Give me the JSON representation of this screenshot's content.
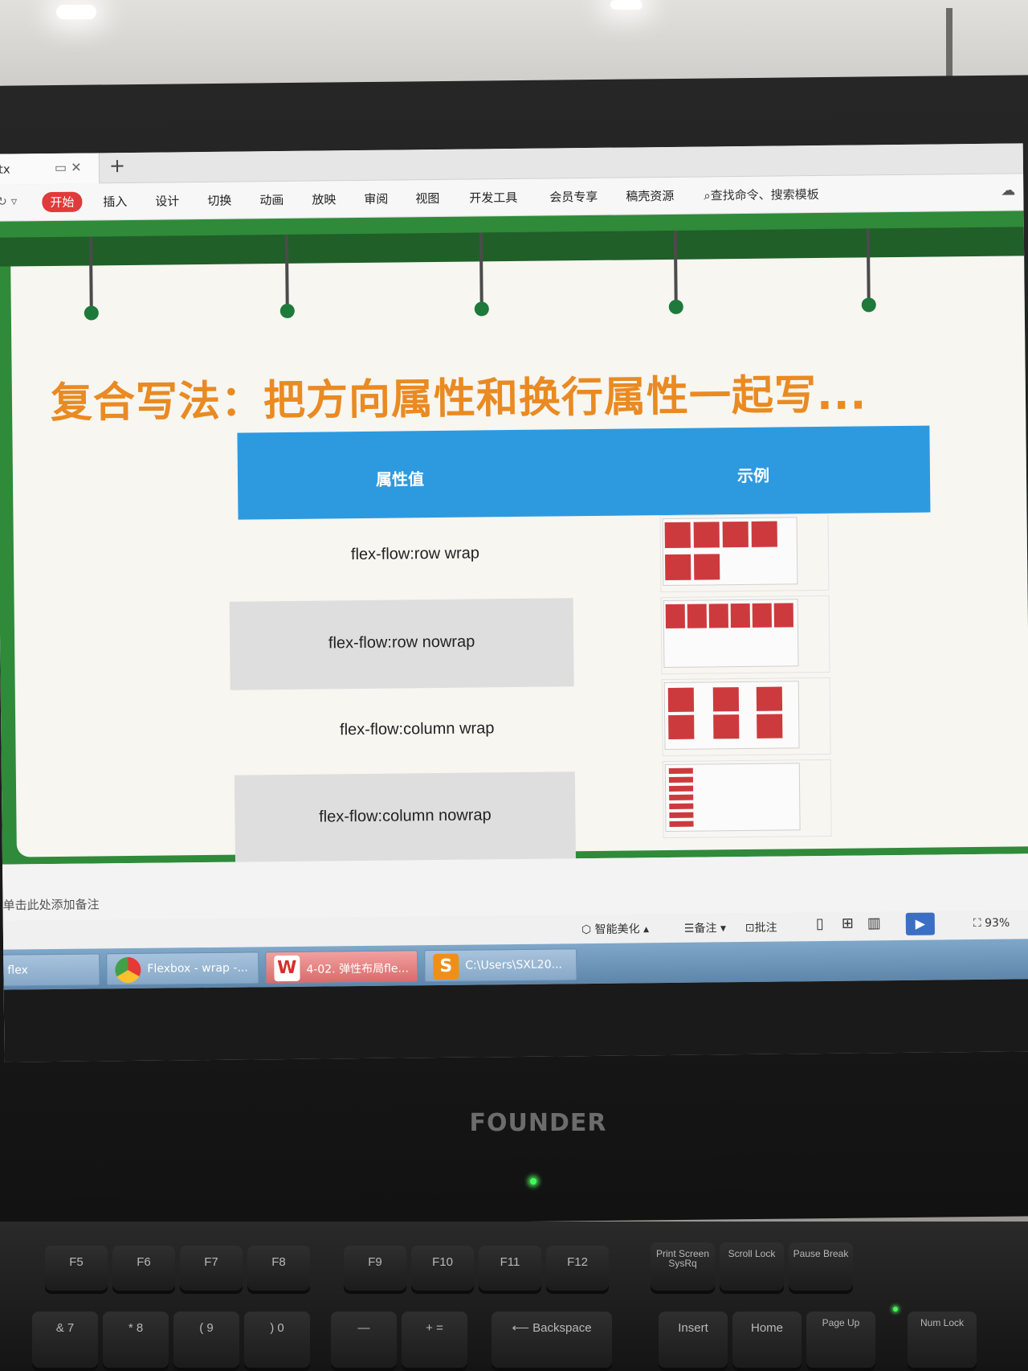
{
  "app": {
    "tab_name": "tx",
    "ribbon": [
      "开始",
      "插入",
      "设计",
      "切换",
      "动画",
      "放映",
      "审阅",
      "视图",
      "开发工具",
      "会员专享",
      "稿壳资源"
    ],
    "search_label": "查找命令、搜索模板"
  },
  "slide": {
    "title": "复合写法：把方向属性和换行属性一起写...",
    "table": {
      "headers": [
        "属性值",
        "示例"
      ],
      "rows": [
        {
          "label": "flex-flow:row wrap"
        },
        {
          "label": "flex-flow:row nowrap"
        },
        {
          "label": "flex-flow:column wrap"
        },
        {
          "label": "flex-flow:column nowrap"
        }
      ]
    }
  },
  "notes": {
    "placeholder": "单击此处添加备注"
  },
  "statusbar": {
    "beautify": "智能美化",
    "notes": "备注",
    "comments": "批注",
    "zoom": "93%"
  },
  "taskbar": [
    {
      "label": "flex"
    },
    {
      "label": "Flexbox - wrap -..."
    },
    {
      "label": "4-02. 弹性布局fle..."
    },
    {
      "label": "C:\\Users\\SXL20..."
    }
  ],
  "monitor": {
    "brand": "FOUNDER"
  },
  "keyboard": {
    "top_row": [
      "F5",
      "F6",
      "F7",
      "F8",
      "F9",
      "F10",
      "F11",
      "F12",
      "Print Screen SysRq",
      "Scroll Lock",
      "Pause Break"
    ],
    "bottom_row": [
      "& 7",
      "* 8",
      "( 9",
      ") 0",
      "—",
      "+ =",
      "Backspace",
      "Insert",
      "Home",
      "Page Up",
      "Num Lock"
    ]
  },
  "colors": {
    "title": "#e98a22",
    "header": "#2d9ae0",
    "block": "#cd3a3d",
    "slide_frame": "#2f8a3a"
  }
}
